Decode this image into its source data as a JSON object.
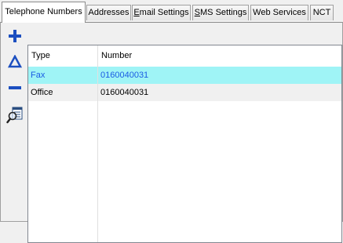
{
  "tabs": [
    {
      "label": "Telephone Numbers",
      "active": true
    },
    {
      "label": "Addresses",
      "active": false
    },
    {
      "label": "Email Settings",
      "active": false,
      "mnemonic": "E",
      "rest": "mail Settings"
    },
    {
      "label": "SMS Settings",
      "active": false,
      "mnemonic": "S",
      "rest": "MS Settings"
    },
    {
      "label": "Web Services",
      "active": false
    },
    {
      "label": "NCT",
      "active": false
    }
  ],
  "toolbar": {
    "add_icon": "plus-icon",
    "edit_icon": "delta-icon",
    "remove_icon": "minus-icon",
    "lookup_icon": "magnifier-list-icon"
  },
  "grid": {
    "columns": [
      "Type",
      "Number"
    ],
    "rows": [
      {
        "type": "Fax",
        "number": "0160040031",
        "selected": true
      },
      {
        "type": "Office",
        "number": "0160040031",
        "selected": false
      }
    ]
  },
  "colors": {
    "selection_bg": "#9ff4f6",
    "selection_text": "#1a5be3",
    "icon_blue": "#1c4fc0"
  }
}
